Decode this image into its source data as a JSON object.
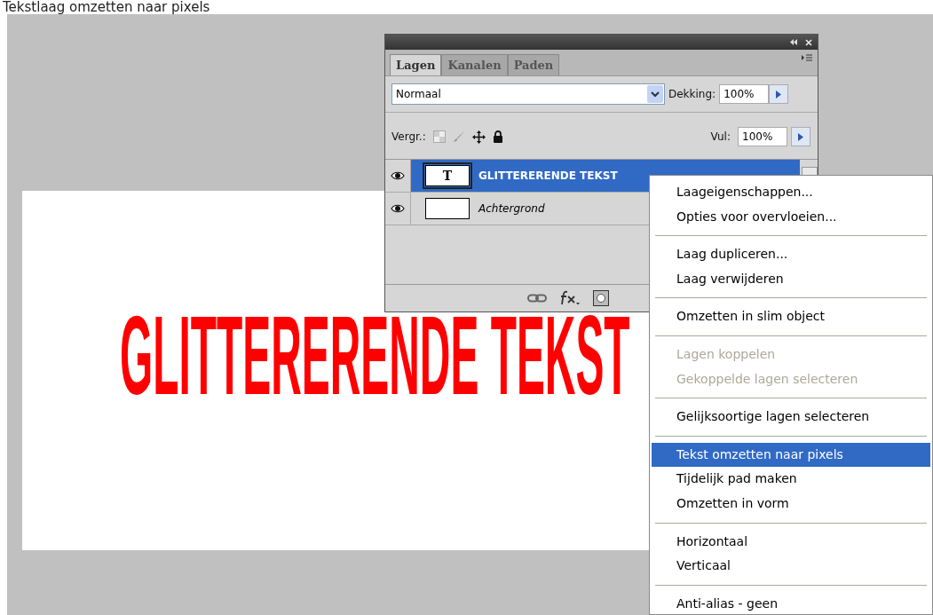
{
  "heading": "Tekstlaag omzetten naar pixels",
  "canvas": {
    "text": "GLITTERERENDE TEKST"
  },
  "panel": {
    "tabs": [
      {
        "label": "Lagen",
        "selected": true
      },
      {
        "label": "Kanalen",
        "selected": false
      },
      {
        "label": "Paden",
        "selected": false
      }
    ],
    "blend_mode": "Normaal",
    "opacity": {
      "label": "Dekking:",
      "value": "100%"
    },
    "lock_label": "Vergr.:",
    "fill": {
      "label": "Vul:",
      "value": "100%"
    },
    "layers": [
      {
        "name": "GLITTERERENDE TEKST",
        "kind": "text",
        "thumb": "T",
        "selected": true,
        "visible": true
      },
      {
        "name": "Achtergrond",
        "kind": "background",
        "selected": false,
        "visible": true
      }
    ]
  },
  "context_menu": {
    "items": [
      {
        "kind": "item",
        "label": "Laageigenschappen...",
        "disabled": false,
        "selected": false
      },
      {
        "kind": "item",
        "label": "Opties voor overvloeien...",
        "disabled": false,
        "selected": false
      },
      {
        "kind": "separator"
      },
      {
        "kind": "item",
        "label": "Laag dupliceren...",
        "disabled": false,
        "selected": false
      },
      {
        "kind": "item",
        "label": "Laag verwijderen",
        "disabled": false,
        "selected": false
      },
      {
        "kind": "separator"
      },
      {
        "kind": "item",
        "label": "Omzetten in slim object",
        "disabled": false,
        "selected": false
      },
      {
        "kind": "separator"
      },
      {
        "kind": "item",
        "label": "Lagen koppelen",
        "disabled": true,
        "selected": false
      },
      {
        "kind": "item",
        "label": "Gekoppelde lagen selecteren",
        "disabled": true,
        "selected": false
      },
      {
        "kind": "separator"
      },
      {
        "kind": "item",
        "label": "Gelijksoortige lagen selecteren",
        "disabled": false,
        "selected": false
      },
      {
        "kind": "separator"
      },
      {
        "kind": "item",
        "label": "Tekst omzetten naar pixels",
        "disabled": false,
        "selected": true
      },
      {
        "kind": "item",
        "label": "Tijdelijk pad maken",
        "disabled": false,
        "selected": false
      },
      {
        "kind": "item",
        "label": "Omzetten in vorm",
        "disabled": false,
        "selected": false
      },
      {
        "kind": "separator"
      },
      {
        "kind": "item",
        "label": "Horizontaal",
        "disabled": false,
        "selected": false
      },
      {
        "kind": "item",
        "label": "Verticaal",
        "disabled": false,
        "selected": false
      },
      {
        "kind": "separator"
      },
      {
        "kind": "item",
        "label": "Anti-alias - geen",
        "disabled": false,
        "selected": false
      }
    ]
  }
}
